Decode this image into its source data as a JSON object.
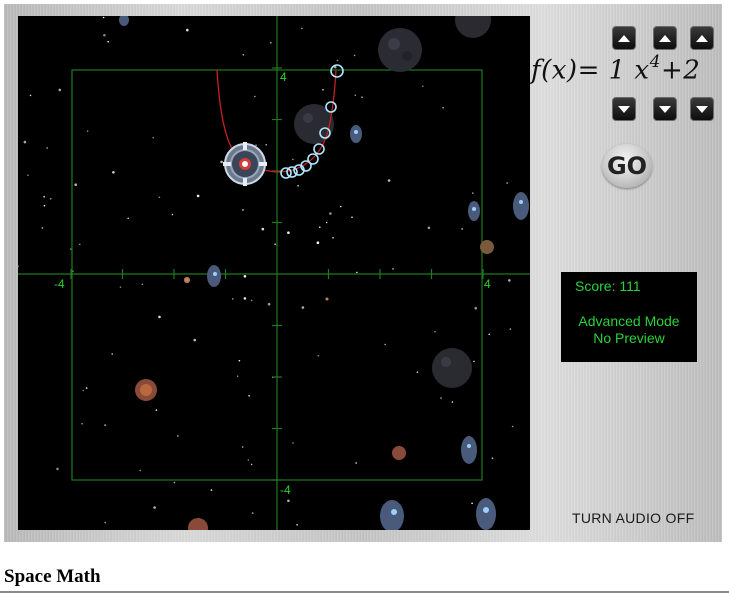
{
  "graph": {
    "x_labels": [
      "-4",
      "4"
    ],
    "y_labels": [
      "4",
      "-4"
    ],
    "x_range": [
      -4,
      4
    ],
    "y_range": [
      -4,
      4
    ],
    "tick_step": 1
  },
  "function": {
    "prefix": "f(x)= ",
    "coefficient": "1",
    "variable": " x",
    "exponent": "4",
    "suffix": "+2"
  },
  "controls": {
    "go_label": "GO",
    "audio_label": "TURN AUDIO OFF"
  },
  "score": {
    "text": "Score: 111",
    "mode_line1": "Advanced Mode",
    "mode_line2": "No Preview"
  },
  "page": {
    "title": "Space Math"
  },
  "colors": {
    "grid": "#1f7a1f",
    "axis_label": "#2bd12b",
    "curve": "#c62020",
    "score_text": "#29d23b"
  }
}
